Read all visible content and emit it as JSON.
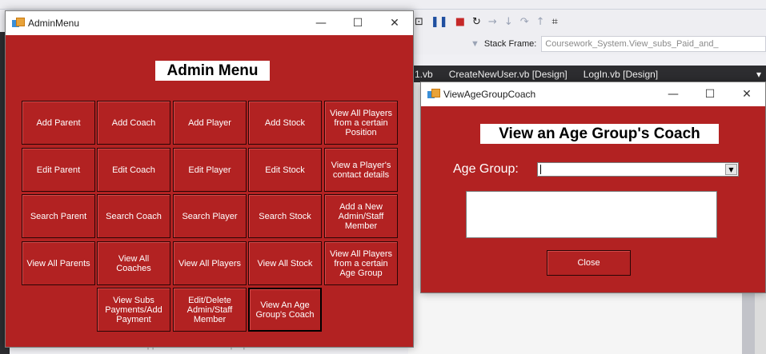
{
  "ide": {
    "stack_frame_label": "Stack Frame:",
    "stack_frame_value": "Coursework_System.View_subs_Paid_and_",
    "tabs": [
      "1.vb",
      "CreateNewUser.vb [Design]",
      "LogIn.vb [Design]"
    ],
    "bottom_text": "Windows application framework properties"
  },
  "admin_window": {
    "title": "AdminMenu",
    "heading": "Admin Menu",
    "buttons": {
      "add_parent": "Add Parent",
      "add_coach": "Add Coach",
      "add_player": "Add Player",
      "add_stock": "Add Stock",
      "view_players_position": "View All Players from a certain Position",
      "edit_parent": "Edit Parent",
      "edit_coach": "Edit Coach",
      "edit_player": "Edit Player",
      "edit_stock": "Edit Stock",
      "view_contact": "View a Player's contact details",
      "search_parent": "Search Parent",
      "search_coach": "Search Coach",
      "search_player": "Search Player",
      "search_stock": "Search Stock",
      "add_admin": "Add a New Admin/Staff Member",
      "view_parents": "View All Parents",
      "view_coaches": "View All Coaches",
      "view_players": "View All Players",
      "view_stock": "View All Stock",
      "view_players_age": "View All Players from a certain Age Group",
      "view_subs": "View Subs Payments/Add Payment",
      "edit_admin": "Edit/Delete Admin/Staff Member",
      "view_age_coach": "View An Age Group's Coach"
    }
  },
  "age_window": {
    "title": "ViewAgeGroupCoach",
    "heading": "View an Age Group's Coach",
    "age_label": "Age Group:",
    "close_label": "Close"
  },
  "window_controls": {
    "minimize": "—",
    "maximize": "☐",
    "close": "✕"
  },
  "colors": {
    "form_background": "#b22222",
    "ide_tab_bar": "#2d2d30"
  }
}
